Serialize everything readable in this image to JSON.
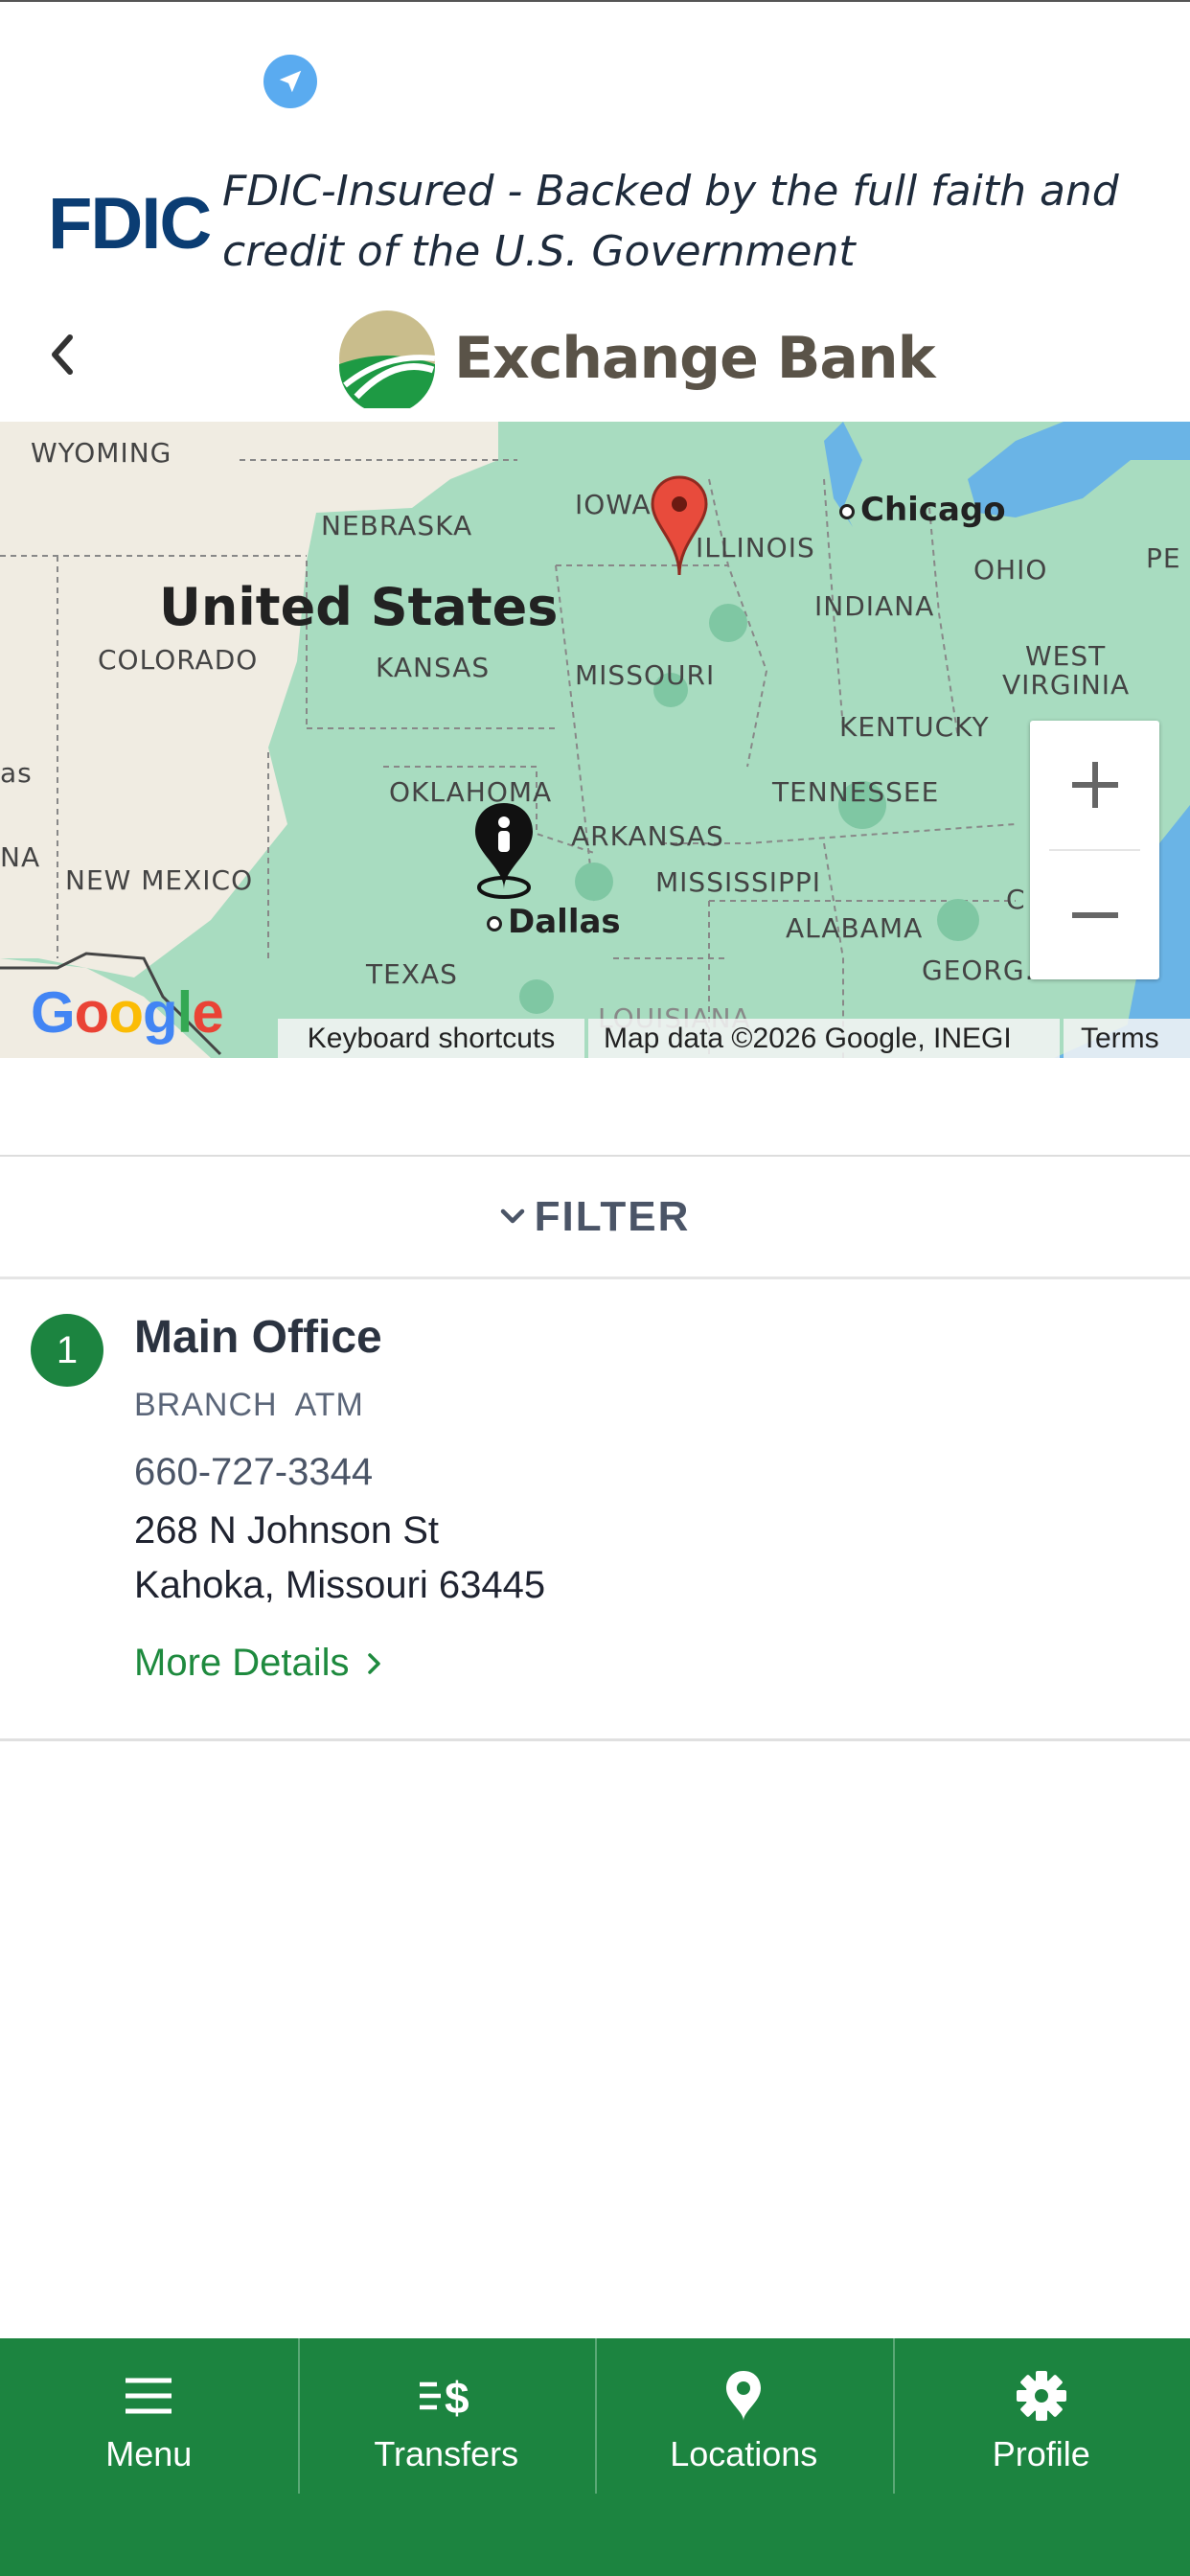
{
  "fdic": {
    "logo_text": "FDIC",
    "notice_line1": "FDIC-Insured - Backed by the full faith and",
    "notice_line2": "credit of the U.S. Government"
  },
  "header": {
    "brand_name": "Exchange Bank",
    "back_icon": "chevron-left-icon"
  },
  "map": {
    "region_label": "United States",
    "state_labels": [
      "WYOMING",
      "NEBRASKA",
      "IOWA",
      "ILLINOIS",
      "INDIANA",
      "OHIO",
      "COLORADO",
      "KANSAS",
      "MISSOURI",
      "KENTUCKY",
      "OKLAHOMA",
      "ARKANSAS",
      "TENNESSEE",
      "MISSISSIPPI",
      "ALABAMA",
      "NEW MEXICO",
      "TEXAS",
      "GEORG...",
      "WEST",
      "VIRGINIA",
      "LOUISIANA",
      "PE",
      "as",
      "NA",
      "C"
    ],
    "cities": [
      "Chicago",
      "Dallas"
    ],
    "zoom_in_label": "+",
    "zoom_out_label": "−",
    "attribution": {
      "google": "Google",
      "shortcuts": "Keyboard shortcuts",
      "data": "Map data ©2026 Google, INEGI",
      "terms": "Terms"
    },
    "colors": {
      "land": "#a8dcc0",
      "desert": "#f0ece2",
      "water": "#6ab4e6",
      "pin": "#e84b3c"
    }
  },
  "filter": {
    "label": "FILTER"
  },
  "locations": [
    {
      "number": "1",
      "name": "Main Office",
      "tags": [
        "BRANCH",
        "ATM"
      ],
      "phone": "660-727-3344",
      "address_line1": "268 N Johnson St",
      "address_line2": "Kahoka, Missouri 63445",
      "more_label": "More Details"
    }
  ],
  "bottom_nav": [
    {
      "label": "Menu",
      "icon": "menu-icon"
    },
    {
      "label": "Transfers",
      "icon": "transfers-icon"
    },
    {
      "label": "Locations",
      "icon": "location-pin-icon"
    },
    {
      "label": "Profile",
      "icon": "gear-icon"
    }
  ],
  "colors": {
    "brand_green": "#1c8440",
    "link_green": "#1e8a3e",
    "fdic_navy": "#0b3d73"
  }
}
